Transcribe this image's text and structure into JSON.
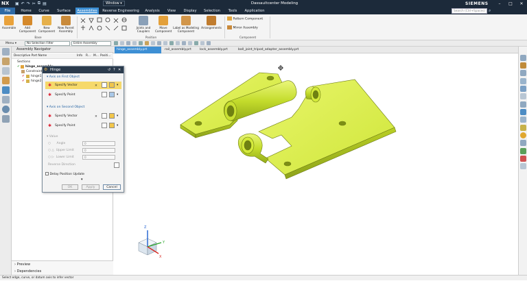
{
  "titlebar": {
    "logo": "NX",
    "window_menu": "Window",
    "app_title": "Dassaultcenter Modeling",
    "brand": "SIEMENS"
  },
  "menubar": {
    "items": [
      "File",
      "Home",
      "Curve",
      "Surface",
      "Assemblies",
      "Reverse Engineering",
      "Analysis",
      "View",
      "Display",
      "Selection",
      "Tools",
      "Application"
    ],
    "active": "Assemblies",
    "search_placeholder": "Search (Ctrl+Spaces)"
  },
  "ribbon": {
    "buttons": [
      "Assemble",
      "Add Component",
      "New Component",
      "New Parent Assembly",
      "Joints and Couplers",
      "Move Component",
      "Label as Modeling Component",
      "Arrangements"
    ],
    "component_items": [
      "Pattern Component",
      "Mirror Assembly"
    ],
    "groups": [
      "Base",
      "Position",
      "Component"
    ]
  },
  "toolbar2": {
    "menu_label": "Menu",
    "selection_filter": "No Selection Filter",
    "scope": "Entire Assembly"
  },
  "navigator": {
    "title": "Assembly Navigator",
    "columns": [
      "Descriptive Part Name",
      "Info",
      "R...",
      "M...",
      "Positi..."
    ],
    "rows": [
      "Sections",
      "hinge_assembly",
      "Constraints",
      "hinge1",
      "hinge2"
    ],
    "bottom": [
      "Preview",
      "Dependencies"
    ]
  },
  "tabs": [
    "hinge_assembly.prt",
    "rail_assembly.prt",
    "lock_assembly.prt",
    "ball_joint_tripod_adapter_assembly.prt"
  ],
  "dialog": {
    "title": "Hinge",
    "sec1": "Axis on First Object",
    "sec2": "Axis on Second Object",
    "sec3": "Value",
    "specify_vector": "Specify Vector",
    "specify_point": "Specify Point",
    "angle_label": "Angle",
    "upper_label": "Upper Limit",
    "lower_label": "Lower Limit",
    "reverse_label": "Reverse Direction",
    "angle_val": "0",
    "upper_val": "0",
    "lower_val": "0",
    "delay_label": "Delay Position Update",
    "ok": "OK",
    "apply": "Apply",
    "cancel": "Cancel"
  },
  "status": "Select edge, curve, or datum axis to infer vector",
  "triad": {
    "x": "X",
    "y": "Y",
    "z": "Z"
  },
  "colors": {
    "title_bg": "#1c2a3a",
    "accent": "#3d8fd4",
    "part": "#d6ec3b",
    "highlight": "#f6d96b"
  }
}
